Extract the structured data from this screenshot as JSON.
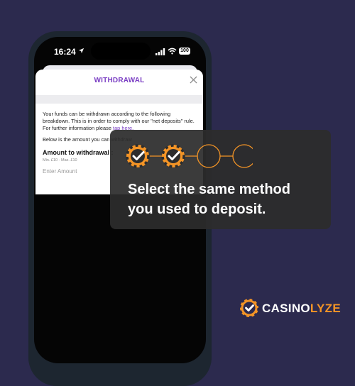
{
  "status_bar": {
    "time": "16:24",
    "battery": "100"
  },
  "withdrawal": {
    "title": "WITHDRAWAL",
    "info_text": "Your funds can be withdrawn according to the following breakdown. This is in order to comply with our \"net deposits\" rule. For further information please",
    "info_link": "tap here.",
    "amount_intro": "Below is the amount you can withdraw",
    "amount_label": "Amount to withdrawal :",
    "amount_range": "Min. £10 - Max. £10",
    "amount_placeholder": "Enter Amount"
  },
  "overlay": {
    "line1": "Select the same method",
    "line2": "you used to deposit.",
    "steps_total": 4,
    "steps_completed": 2
  },
  "brand": {
    "name_part1": "CASINO",
    "name_part2": "LYZE"
  },
  "colors": {
    "background": "#2c2a4e",
    "accent": "#f39426",
    "title_purple": "#7b3fc4",
    "card": "#2c2c2c"
  }
}
